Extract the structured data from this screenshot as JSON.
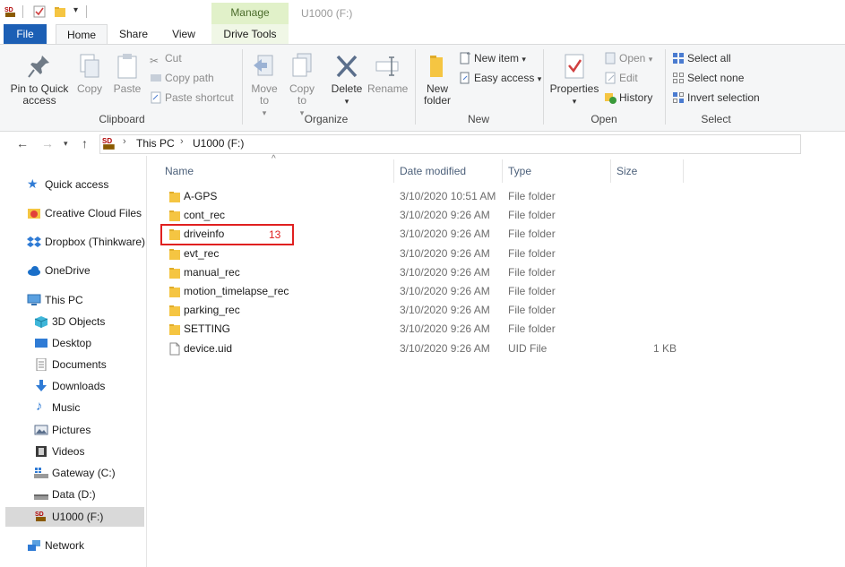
{
  "window": {
    "title": "U1000 (F:)",
    "contextual_tab_group": "Manage"
  },
  "tabs": {
    "file": "File",
    "home": "Home",
    "share": "Share",
    "view": "View",
    "drive_tools": "Drive Tools"
  },
  "ribbon": {
    "clipboard": {
      "label": "Clipboard",
      "pin": "Pin to Quick access",
      "copy": "Copy",
      "paste": "Paste",
      "cut": "Cut",
      "copy_path": "Copy path",
      "paste_shortcut": "Paste shortcut"
    },
    "organize": {
      "label": "Organize",
      "move_to": "Move to",
      "copy_to": "Copy to",
      "delete": "Delete",
      "rename": "Rename"
    },
    "new": {
      "label": "New",
      "new_folder": "New folder",
      "new_item": "New item",
      "easy_access": "Easy access"
    },
    "open": {
      "label": "Open",
      "properties": "Properties",
      "open": "Open",
      "edit": "Edit",
      "history": "History"
    },
    "select": {
      "label": "Select",
      "select_all": "Select all",
      "select_none": "Select none",
      "invert_selection": "Invert selection"
    }
  },
  "address": {
    "crumbs": [
      "This PC",
      "U1000 (F:)"
    ]
  },
  "nav_pane": {
    "quick_access": "Quick access",
    "creative_cloud": "Creative Cloud Files",
    "dropbox": "Dropbox (Thinkware)",
    "onedrive": "OneDrive",
    "this_pc": "This PC",
    "objects_3d": "3D Objects",
    "desktop": "Desktop",
    "documents": "Documents",
    "downloads": "Downloads",
    "music": "Music",
    "pictures": "Pictures",
    "videos": "Videos",
    "gateway": "Gateway (C:)",
    "data": "Data (D:)",
    "u1000": "U1000 (F:)",
    "network": "Network"
  },
  "columns": {
    "name": "Name",
    "date_modified": "Date modified",
    "type": "Type",
    "size": "Size"
  },
  "files": [
    {
      "name": "A-GPS",
      "date": "3/10/2020 10:51 AM",
      "type": "File folder",
      "size": "",
      "icon": "folder-icon"
    },
    {
      "name": "cont_rec",
      "date": "3/10/2020 9:26 AM",
      "type": "File folder",
      "size": "",
      "icon": "folder-icon"
    },
    {
      "name": "driveinfo",
      "date": "3/10/2020 9:26 AM",
      "type": "File folder",
      "size": "",
      "icon": "folder-icon"
    },
    {
      "name": "evt_rec",
      "date": "3/10/2020 9:26 AM",
      "type": "File folder",
      "size": "",
      "icon": "folder-icon"
    },
    {
      "name": "manual_rec",
      "date": "3/10/2020 9:26 AM",
      "type": "File folder",
      "size": "",
      "icon": "folder-icon"
    },
    {
      "name": "motion_timelapse_rec",
      "date": "3/10/2020 9:26 AM",
      "type": "File folder",
      "size": "",
      "icon": "folder-icon"
    },
    {
      "name": "parking_rec",
      "date": "3/10/2020 9:26 AM",
      "type": "File folder",
      "size": "",
      "icon": "folder-icon"
    },
    {
      "name": "SETTING",
      "date": "3/10/2020 9:26 AM",
      "type": "File folder",
      "size": "",
      "icon": "folder-icon"
    },
    {
      "name": "device.uid",
      "date": "3/10/2020 9:26 AM",
      "type": "UID File",
      "size": "1 KB",
      "icon": "file-icon"
    }
  ],
  "annotation": {
    "badge": "13",
    "color": "#e02020"
  },
  "colors": {
    "file_tab": "#1c5fb5",
    "manage_tab": "#e1f1c9",
    "folder": "#f5c542",
    "selected_nav": "#d9d9d9"
  }
}
